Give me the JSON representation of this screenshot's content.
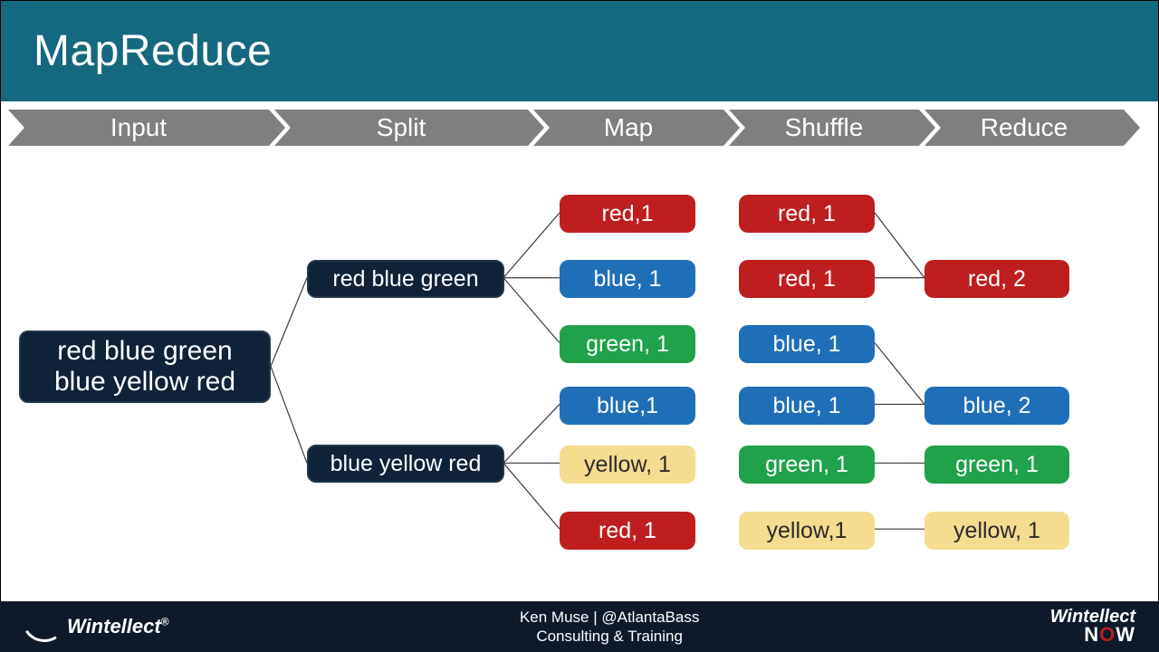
{
  "title": "MapReduce",
  "stages": [
    "Input",
    "Split",
    "Map",
    "Shuffle",
    "Reduce"
  ],
  "input": {
    "label": "red blue green blue yellow red"
  },
  "splits": [
    {
      "label": "red blue green"
    },
    {
      "label": "blue yellow red"
    }
  ],
  "map": [
    {
      "label": "red,1",
      "color": "red"
    },
    {
      "label": "blue, 1",
      "color": "blue"
    },
    {
      "label": "green, 1",
      "color": "green"
    },
    {
      "label": "blue,1",
      "color": "blue"
    },
    {
      "label": "yellow, 1",
      "color": "yellow"
    },
    {
      "label": "red, 1",
      "color": "red"
    }
  ],
  "shuffle": [
    {
      "label": "red, 1",
      "color": "red"
    },
    {
      "label": "red, 1",
      "color": "red"
    },
    {
      "label": "blue, 1",
      "color": "blue"
    },
    {
      "label": "blue, 1",
      "color": "blue"
    },
    {
      "label": "green, 1",
      "color": "green"
    },
    {
      "label": "yellow,1",
      "color": "yellow"
    }
  ],
  "reduce": [
    {
      "label": "red, 2",
      "color": "red"
    },
    {
      "label": "blue, 2",
      "color": "blue"
    },
    {
      "label": "green, 1",
      "color": "green"
    },
    {
      "label": "yellow, 1",
      "color": "yellow"
    }
  ],
  "footer": {
    "brand_left": "Wintellect",
    "center_top": "Ken Muse   |   @AtlantaBass",
    "center_bottom": "Consulting & Training",
    "brand_right_top": "Wintellect",
    "brand_right_bottom": "NOW"
  },
  "colors": {
    "title_bg": "#14687F",
    "stage_bg": "#7F7F7F",
    "dark": "#0F2238",
    "red": "#BF1E1E",
    "blue": "#1F6FB8",
    "green": "#1FA24A",
    "yellow": "#F4DD8F"
  }
}
